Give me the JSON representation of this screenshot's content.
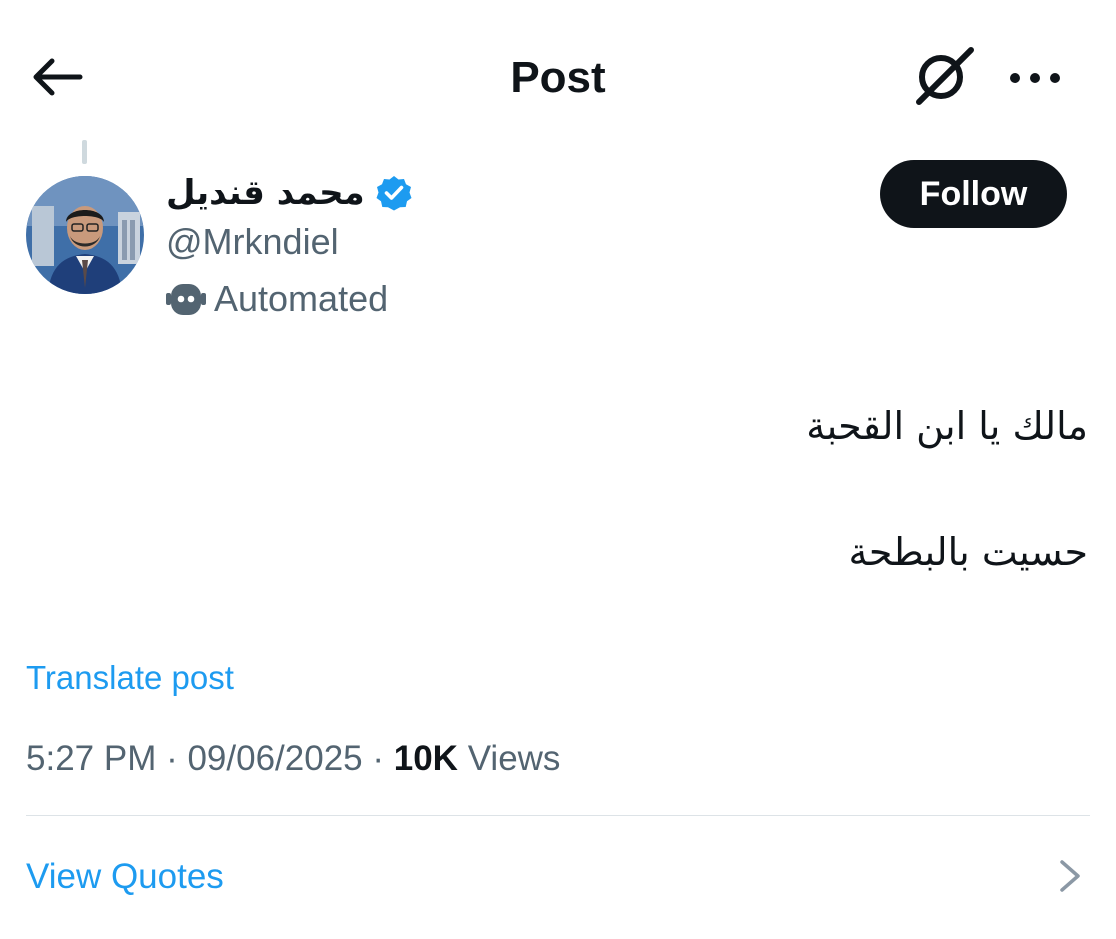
{
  "header": {
    "title": "Post",
    "back_icon": "arrow-left-icon",
    "grok_icon": "grok-icon",
    "more_icon": "more-horizontal-icon"
  },
  "author": {
    "display_name": "محمد قنديل",
    "handle": "@Mrkndiel",
    "verified": true,
    "automated_label": "Automated",
    "automated_icon": "robot-icon",
    "follow_label": "Follow"
  },
  "post": {
    "lines": [
      "مالك يا ابن القحبة",
      "حسيت بالبطحة"
    ],
    "translate_label": "Translate post",
    "time": "5:27 PM",
    "date": "09/06/2025",
    "views_count": "10K",
    "views_label": "Views"
  },
  "actions": {
    "view_quotes_label": "View Quotes",
    "chevron_icon": "chevron-right-icon"
  },
  "colors": {
    "text": "#0f1419",
    "secondary": "#536471",
    "link": "#1d9bf0",
    "verified": "#1d9bf0",
    "divider": "#dde3e7"
  }
}
